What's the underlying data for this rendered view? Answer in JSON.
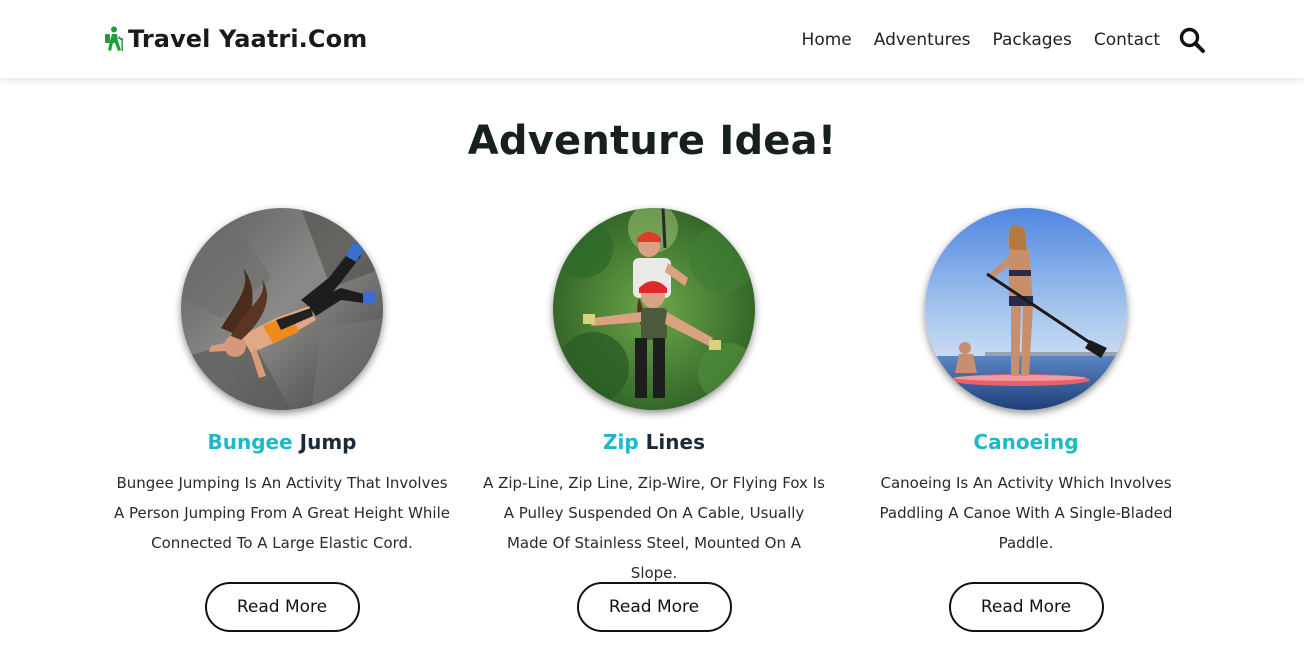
{
  "header": {
    "brand": "Travel Yaatri.Com",
    "brand_icon": "hiker-icon",
    "brand_color": "#1f9d3a",
    "nav": [
      "Home",
      "Adventures",
      "Packages",
      "Contact"
    ],
    "search_icon": "search-icon"
  },
  "main": {
    "title": "Adventure Idea!",
    "accent_color": "#1db8c9",
    "cards": [
      {
        "title_accent": "Bungee",
        "title_rest": "Jump",
        "description": "Bungee Jumping Is An Activity That Involves A Person Jumping From A Great Height While Connected To A Large Elastic Cord.",
        "button": "Read More",
        "image": "bungee-jump-photo"
      },
      {
        "title_accent": "Zip",
        "title_rest": "Lines",
        "description": "A Zip-Line, Zip Line, Zip-Wire, Or Flying Fox Is A Pulley Suspended On A Cable, Usually Made Of Stainless Steel, Mounted On A Slope.",
        "button": "Read More",
        "image": "zip-line-photo"
      },
      {
        "title_accent": "Canoeing",
        "title_rest": "",
        "description": "Canoeing Is An Activity Which Involves Paddling A Canoe With A Single-Bladed Paddle.",
        "button": "Read More",
        "image": "canoeing-photo"
      }
    ]
  }
}
